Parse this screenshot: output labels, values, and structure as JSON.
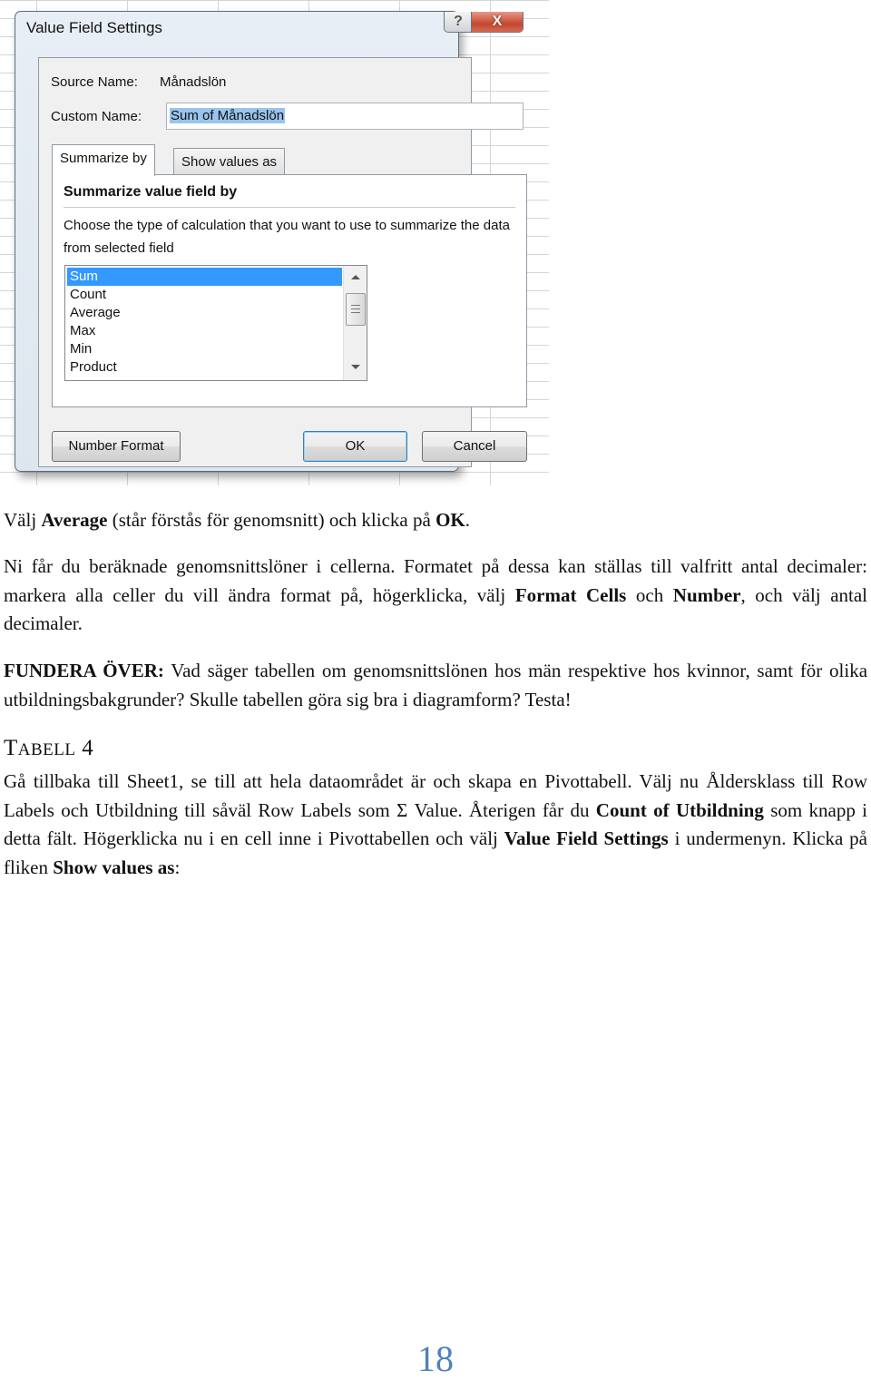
{
  "dialog": {
    "title": "Value Field Settings",
    "help_button": "?",
    "close_button": "X",
    "source_name_label": "Source Name:",
    "source_name_value": "Månadslön",
    "custom_name_label": "Custom Name:",
    "custom_name_value": "Sum of Månadslön",
    "tabs": [
      {
        "label": "Summarize by",
        "active": true
      },
      {
        "label": "Show values as",
        "active": false
      }
    ],
    "panel_title": "Summarize value field by",
    "panel_description": "Choose the type of calculation that you want to use to summarize the data from selected field",
    "list_items": [
      "Sum",
      "Count",
      "Average",
      "Max",
      "Min",
      "Product"
    ],
    "selected_item": "Sum",
    "buttons": {
      "number_format": "Number Format",
      "ok": "OK",
      "cancel": "Cancel"
    }
  },
  "document": {
    "p1": {
      "t1": "Välj ",
      "b1": "Average",
      "t2": " (står förstås för genomsnitt) och klicka på ",
      "b2": "OK",
      "t3": "."
    },
    "p2": {
      "t1": "Ni får du beräknade genomsnittslöner i cellerna. Formatet på dessa kan ställas till valfritt antal decimaler: markera alla celler du vill ändra format på, högerklicka, välj ",
      "b1": "Format Cells",
      "t2": " och ",
      "b2": "Number",
      "t3": ", och välj antal decimaler."
    },
    "p3": {
      "b1": "FUNDERA ÖVER:",
      "t1": " Vad säger tabellen om genomsnittslönen hos män respektive hos kvinnor, samt för olika utbildningsbakgrunder? Skulle tabellen göra sig bra i diagramform? Testa!"
    },
    "heading": {
      "first": "T",
      "rest": "ABELL",
      "num": " 4"
    },
    "p4": {
      "t1": "Gå tillbaka till Sheet1, se till att hela dataområdet är och skapa en Pivottabell. Välj nu Åldersklass till Row Labels och Utbildning till såväl Row Labels som Σ Value. Återigen får du ",
      "b1": "Count of Utbildning",
      "t2": " som knapp i detta fält. Högerklicka nu i en cell inne i Pivottabellen och välj ",
      "b2": "Value Field Settings",
      "t3": " i undermenyn.  Klicka på fliken ",
      "b3": "Show values as",
      "t4": ":"
    },
    "page_number": "18"
  }
}
